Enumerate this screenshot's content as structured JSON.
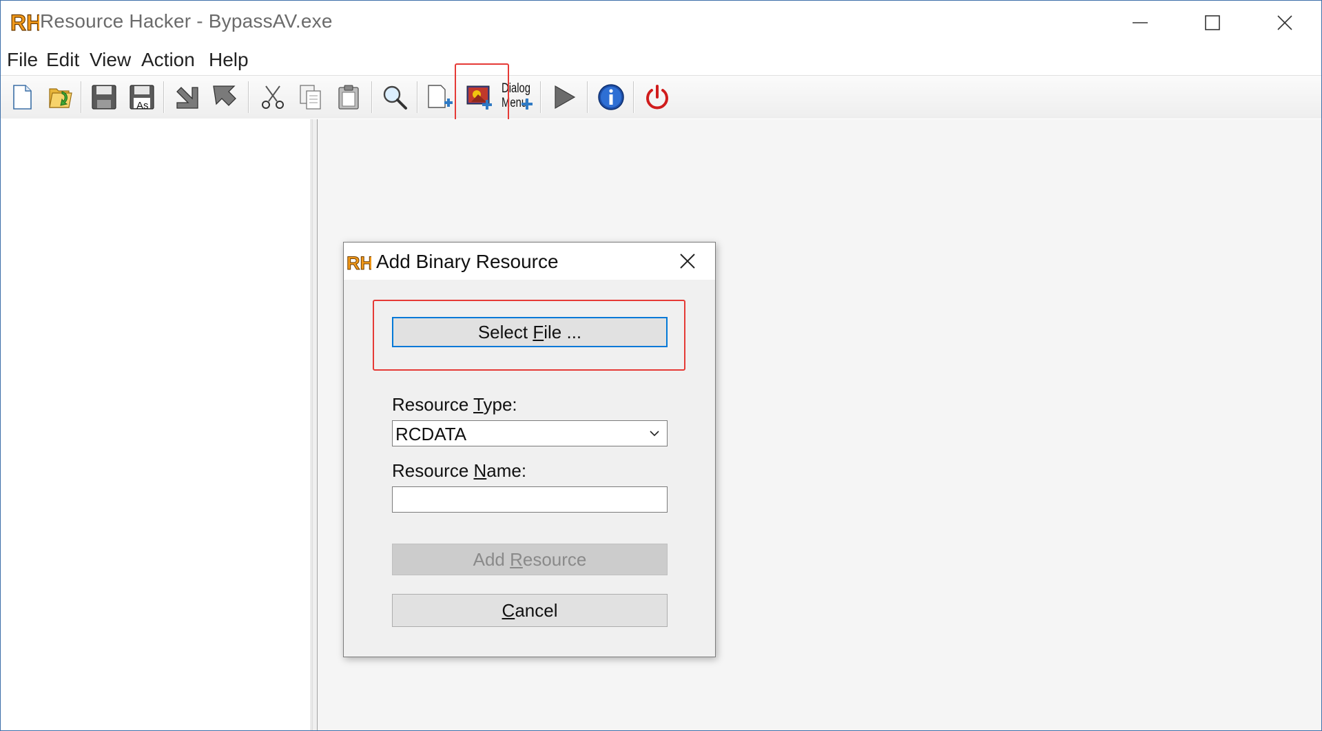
{
  "window": {
    "title": "Resource Hacker - BypassAV.exe",
    "controls": [
      "minimize",
      "maximize",
      "close"
    ]
  },
  "menu": [
    "File",
    "Edit",
    "View",
    "Action",
    "Help"
  ],
  "toolbar": {
    "buttons": [
      {
        "icon": "new-file-icon"
      },
      {
        "icon": "open-folder-icon"
      },
      {
        "icon": "save-icon"
      },
      {
        "icon": "save-as-icon",
        "badge": "As"
      },
      {
        "icon": "compile-arrow-icon"
      },
      {
        "icon": "compile-arrow-icon"
      },
      {
        "icon": "cut-icon"
      },
      {
        "icon": "copy-icon"
      },
      {
        "icon": "paste-icon"
      },
      {
        "icon": "search-icon"
      },
      {
        "icon": "add-blank-resource-icon"
      },
      {
        "icon": "add-binary-resource-icon"
      },
      {
        "icon": "dialog-menu-icon",
        "text_line1": "Dialog",
        "text_line2": "Menu"
      },
      {
        "icon": "run-icon"
      },
      {
        "icon": "info-icon"
      },
      {
        "icon": "power-icon"
      }
    ]
  },
  "dialog": {
    "title": "Add Binary Resource",
    "select_file_pre": "Select ",
    "select_file_mn": "F",
    "select_file_post": "ile ...",
    "resource_type_label_pre": "Resource ",
    "resource_type_label_mn": "T",
    "resource_type_label_post": "ype:",
    "resource_type_value": "RCDATA",
    "resource_name_label_pre": "Resource ",
    "resource_name_label_mn": "N",
    "resource_name_label_post": "ame:",
    "resource_name_value": "",
    "add_resource_pre": "Add ",
    "add_resource_mn": "R",
    "add_resource_post": "esource",
    "cancel_mn": "C",
    "cancel_post": "ancel"
  },
  "colors": {
    "highlight_box": "#e53935",
    "focus_border": "#0078d7",
    "logo_orange": "#f29a1a"
  }
}
